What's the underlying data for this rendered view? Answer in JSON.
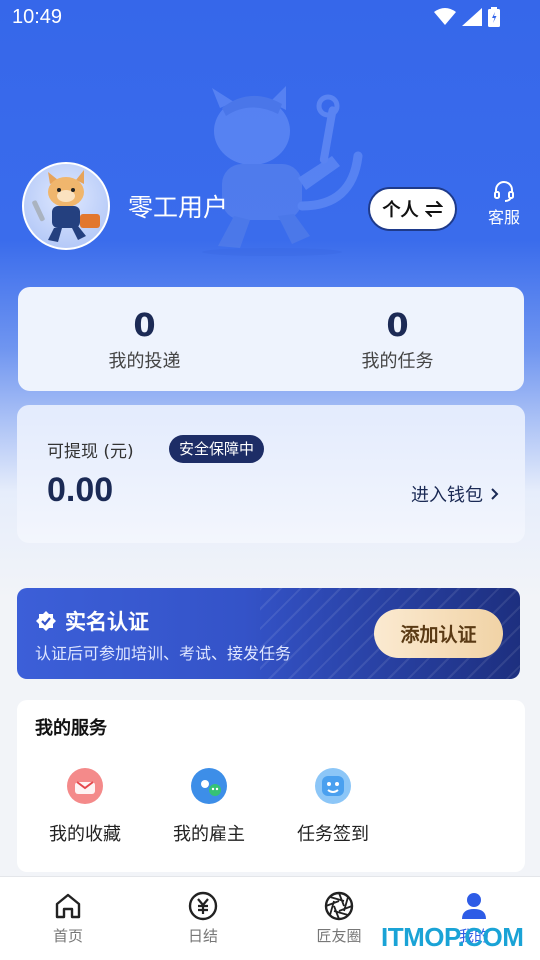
{
  "status_bar": {
    "time": "10:49"
  },
  "profile": {
    "username": "零工用户",
    "switch_label": "个人",
    "switch_icon": "swap-arrows-icon",
    "support_label": "客服"
  },
  "stats": [
    {
      "value": "0",
      "label": "我的投递"
    },
    {
      "value": "0",
      "label": "我的任务"
    }
  ],
  "wallet": {
    "label": "可提现 (元)",
    "badge": "安全保障中",
    "amount": "0.00",
    "link": "进入钱包"
  },
  "verification": {
    "title": "实名认证",
    "subtitle": "认证后可参加培训、考试、接发任务",
    "button": "添加认证"
  },
  "services": {
    "title": "我的服务",
    "items": [
      {
        "label": "我的收藏",
        "icon": "favorites-icon",
        "color": "#f26b6b"
      },
      {
        "label": "我的雇主",
        "icon": "employer-icon",
        "color": "#3d8ee8"
      },
      {
        "label": "任务签到",
        "icon": "checkin-icon",
        "color": "#5aa8f0"
      }
    ]
  },
  "tabbar": {
    "items": [
      {
        "label": "首页",
        "icon": "home-icon"
      },
      {
        "label": "日结",
        "icon": "yen-icon"
      },
      {
        "label": "匠友圈",
        "icon": "aperture-icon"
      },
      {
        "label": "我的",
        "icon": "person-icon"
      }
    ],
    "active_index": 3
  },
  "watermark": "ITMOP.COM",
  "colors": {
    "primary": "#3667ea",
    "dark_navy": "#1d2d66",
    "gold": "#f1d3a6"
  }
}
